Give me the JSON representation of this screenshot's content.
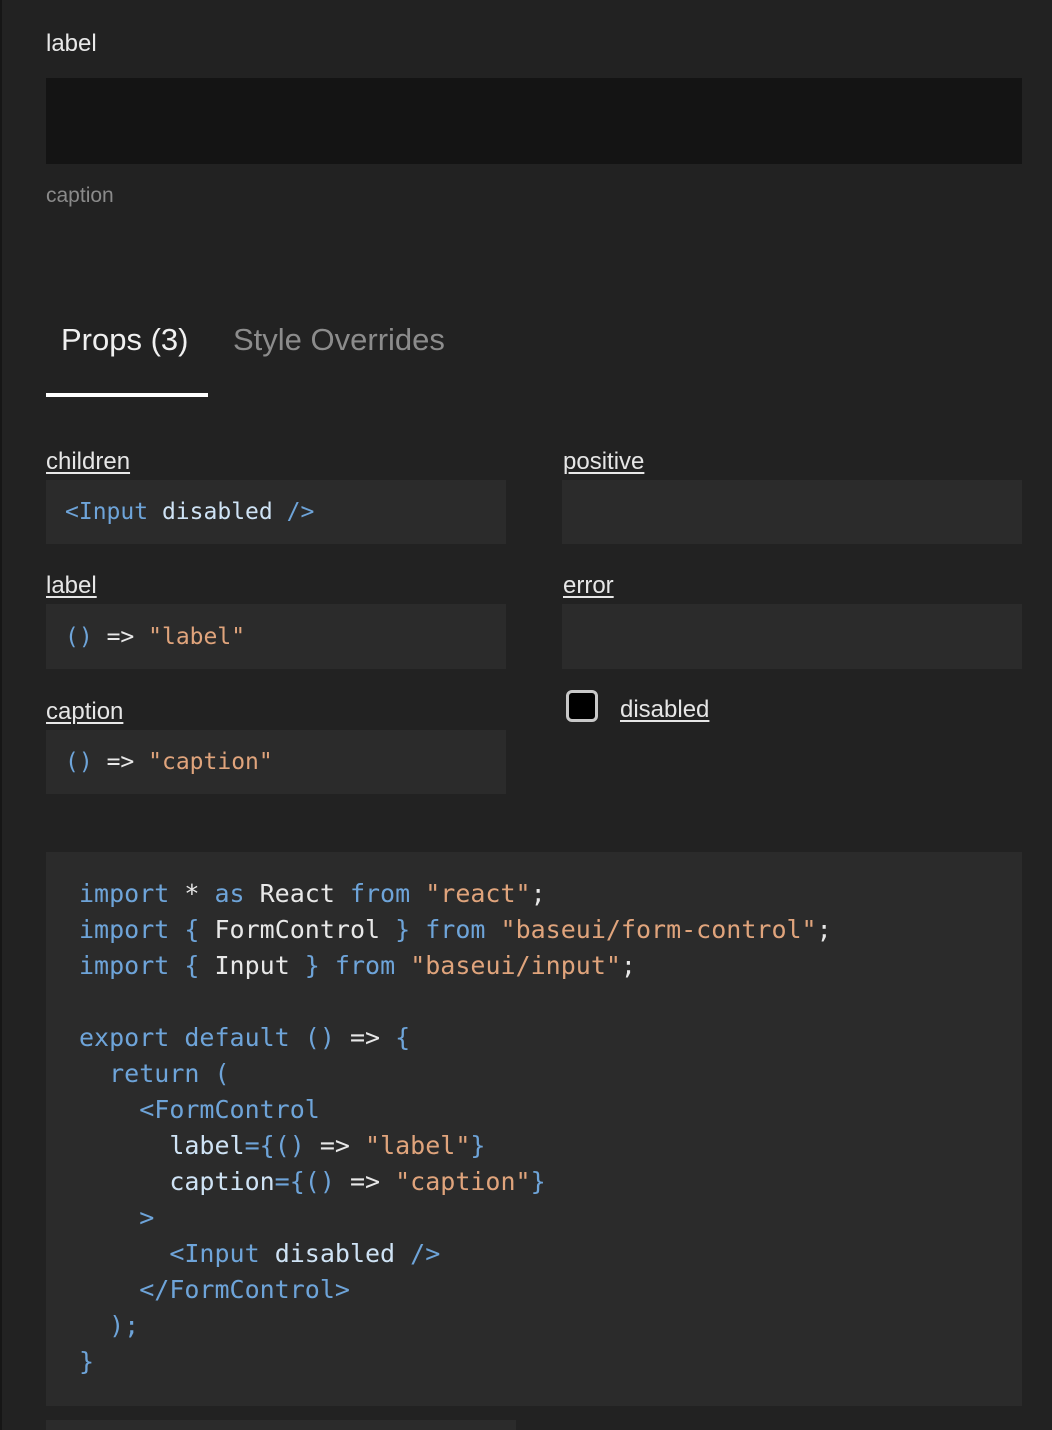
{
  "preview": {
    "label": "label",
    "input_value": "",
    "caption": "caption"
  },
  "tabs": [
    {
      "label": "Props (3)",
      "active": true
    },
    {
      "label": "Style Overrides",
      "active": false
    }
  ],
  "props": {
    "children": {
      "label": "children",
      "tokens": [
        "<Input",
        " ",
        "disabled",
        " ",
        "/>"
      ]
    },
    "label": {
      "label": "label",
      "tokens": [
        "()",
        " ",
        "=>",
        " ",
        "\"label\""
      ]
    },
    "caption": {
      "label": "caption",
      "tokens": [
        "()",
        " ",
        "=>",
        " ",
        "\"caption\""
      ]
    },
    "positive": {
      "label": "positive",
      "value": ""
    },
    "error": {
      "label": "error",
      "value": ""
    },
    "disabled": {
      "label": "disabled",
      "checked": false
    }
  },
  "code": {
    "lines": [
      [
        [
          "kw",
          "import"
        ],
        [
          "plain",
          " * "
        ],
        [
          "kw",
          "as"
        ],
        [
          "plain",
          " React "
        ],
        [
          "kw",
          "from"
        ],
        [
          "plain",
          " "
        ],
        [
          "str",
          "\"react\""
        ],
        [
          "plain",
          ";"
        ]
      ],
      [
        [
          "kw",
          "import"
        ],
        [
          "plain",
          " "
        ],
        [
          "punc",
          "{"
        ],
        [
          "plain",
          " FormControl "
        ],
        [
          "punc",
          "}"
        ],
        [
          "plain",
          " "
        ],
        [
          "kw",
          "from"
        ],
        [
          "plain",
          " "
        ],
        [
          "str",
          "\"baseui/form-control\""
        ],
        [
          "plain",
          ";"
        ]
      ],
      [
        [
          "kw",
          "import"
        ],
        [
          "plain",
          " "
        ],
        [
          "punc",
          "{"
        ],
        [
          "plain",
          " Input "
        ],
        [
          "punc",
          "}"
        ],
        [
          "plain",
          " "
        ],
        [
          "kw",
          "from"
        ],
        [
          "plain",
          " "
        ],
        [
          "str",
          "\"baseui/input\""
        ],
        [
          "plain",
          ";"
        ]
      ],
      [],
      [
        [
          "kw",
          "export"
        ],
        [
          "plain",
          " "
        ],
        [
          "kw",
          "default"
        ],
        [
          "plain",
          " "
        ],
        [
          "punc",
          "()"
        ],
        [
          "plain",
          " => "
        ],
        [
          "punc",
          "{"
        ]
      ],
      [
        [
          "plain",
          "  "
        ],
        [
          "kw",
          "return"
        ],
        [
          "plain",
          " "
        ],
        [
          "punc",
          "("
        ]
      ],
      [
        [
          "plain",
          "    "
        ],
        [
          "tag",
          "<FormControl"
        ]
      ],
      [
        [
          "plain",
          "      "
        ],
        [
          "attr",
          "label"
        ],
        [
          "punc",
          "={"
        ],
        [
          "punc",
          "()"
        ],
        [
          "plain",
          " => "
        ],
        [
          "str",
          "\"label\""
        ],
        [
          "punc",
          "}"
        ]
      ],
      [
        [
          "plain",
          "      "
        ],
        [
          "attr",
          "caption"
        ],
        [
          "punc",
          "={"
        ],
        [
          "punc",
          "()"
        ],
        [
          "plain",
          " => "
        ],
        [
          "str",
          "\"caption\""
        ],
        [
          "punc",
          "}"
        ]
      ],
      [
        [
          "plain",
          "    "
        ],
        [
          "tag",
          ">"
        ]
      ],
      [
        [
          "plain",
          "      "
        ],
        [
          "tag",
          "<Input"
        ],
        [
          "plain",
          " "
        ],
        [
          "attr",
          "disabled"
        ],
        [
          "plain",
          " "
        ],
        [
          "tag",
          "/>"
        ]
      ],
      [
        [
          "plain",
          "    "
        ],
        [
          "tag",
          "</FormControl>"
        ]
      ],
      [
        [
          "plain",
          "  "
        ],
        [
          "punc",
          ");"
        ]
      ],
      [
        [
          "punc",
          "}"
        ]
      ]
    ]
  }
}
